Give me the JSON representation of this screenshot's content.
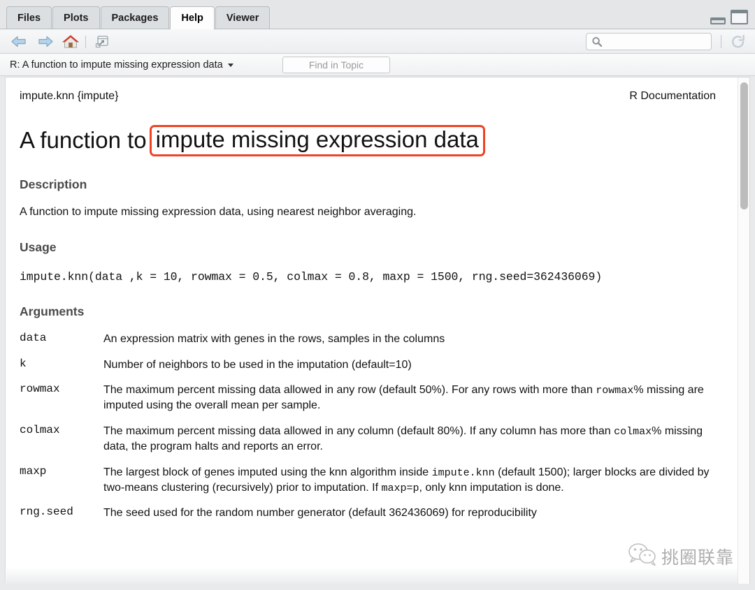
{
  "window": {
    "tabs": [
      {
        "label": "Files",
        "active": false
      },
      {
        "label": "Plots",
        "active": false
      },
      {
        "label": "Packages",
        "active": false
      },
      {
        "label": "Help",
        "active": true
      },
      {
        "label": "Viewer",
        "active": false
      }
    ],
    "controls": {
      "minimize": "minimize",
      "maximize": "maximize"
    }
  },
  "toolbar": {
    "back": "Back",
    "forward": "Forward",
    "home": "Home",
    "popout": "Show in new window",
    "search_value": "",
    "search_placeholder": "",
    "refresh": "Refresh"
  },
  "topic_bar": {
    "topic_title": "R: A function to impute missing expression data",
    "find_value": "",
    "find_placeholder": "Find in Topic"
  },
  "document": {
    "header_left": "impute.knn {impute}",
    "header_right": "R Documentation",
    "title_prefix": "A function to",
    "title_highlighted": "impute missing expression data",
    "highlight_color": "#ee4422",
    "sections": {
      "description_heading": "Description",
      "description_text": "A function to impute missing expression data, using nearest neighbor averaging.",
      "usage_heading": "Usage",
      "usage_code": "impute.knn(data ,k = 10, rowmax = 0.5, colmax = 0.8, maxp = 1500, rng.seed=362436069)",
      "arguments_heading": "Arguments"
    },
    "arguments": [
      {
        "name": "data",
        "desc_parts": [
          {
            "text": "An expression matrix with genes in the rows, samples in the columns",
            "mono": false
          }
        ]
      },
      {
        "name": "k",
        "desc_parts": [
          {
            "text": "Number of neighbors to be used in the imputation (default=10)",
            "mono": false
          }
        ]
      },
      {
        "name": "rowmax",
        "desc_parts": [
          {
            "text": "The maximum percent missing data allowed in any row (default 50%). For any rows with more than ",
            "mono": false
          },
          {
            "text": "rowmax",
            "mono": true
          },
          {
            "text": "% missing are imputed using the overall mean per sample.",
            "mono": false
          }
        ]
      },
      {
        "name": "colmax",
        "desc_parts": [
          {
            "text": "The maximum percent missing data allowed in any column (default 80%). If any column has more than ",
            "mono": false
          },
          {
            "text": "colmax",
            "mono": true
          },
          {
            "text": "% missing data, the program halts and reports an error.",
            "mono": false
          }
        ]
      },
      {
        "name": "maxp",
        "desc_parts": [
          {
            "text": "The largest block of genes imputed using the knn algorithm inside ",
            "mono": false
          },
          {
            "text": "impute.knn",
            "mono": true
          },
          {
            "text": " (default 1500); larger blocks are divided by two-means clustering (recursively) prior to imputation. If ",
            "mono": false
          },
          {
            "text": "maxp=p",
            "mono": true
          },
          {
            "text": ", only knn imputation is done.",
            "mono": false
          }
        ]
      },
      {
        "name": "rng.seed",
        "desc_parts": [
          {
            "text": "The seed used for the random number generator (default 362436069) for reproducibility",
            "mono": false
          }
        ]
      }
    ]
  },
  "scrollbar": {
    "position": "top"
  },
  "watermark": {
    "text": "挑圈联靠",
    "logo": "wechat-logo"
  }
}
